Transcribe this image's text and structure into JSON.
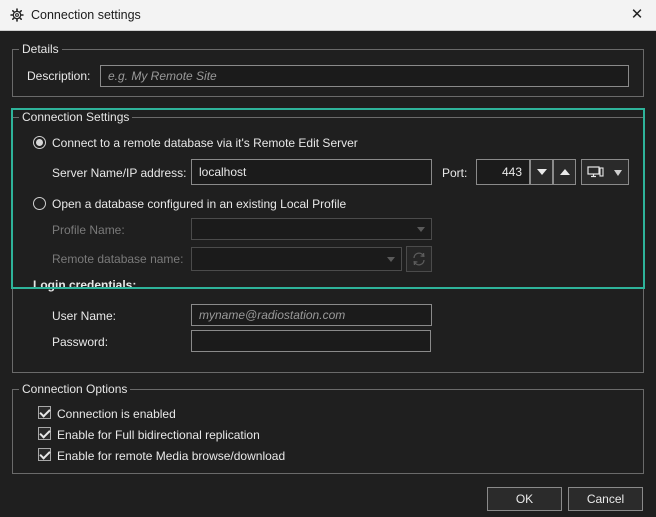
{
  "window": {
    "title": "Connection settings",
    "icon": "gear-icon",
    "close_glyph": "✕"
  },
  "details": {
    "legend": "Details",
    "description_label": "Description:",
    "description_placeholder": "e.g. My Remote Site"
  },
  "connection_settings": {
    "legend": "Connection Settings",
    "option_remote": {
      "label": "Connect to a remote database via it's Remote Edit Server",
      "selected": true
    },
    "server_label": "Server Name/IP address:",
    "server_value": "localhost",
    "port_label": "Port:",
    "port_value": "443",
    "option_local": {
      "label": "Open a database configured in an existing Local Profile",
      "selected": false
    },
    "profile_label": "Profile Name:",
    "remote_db_label": "Remote database name:",
    "login_heading": "Login credentials:",
    "username_label": "User Name:",
    "username_placeholder": "myname@radiostation.com",
    "password_label": "Password:"
  },
  "connection_options": {
    "legend": "Connection Options",
    "items": [
      {
        "label": "Connection is enabled",
        "checked": true
      },
      {
        "label": "Enable for Full bidirectional replication",
        "checked": true
      },
      {
        "label": "Enable for remote Media browse/download",
        "checked": true
      }
    ]
  },
  "buttons": {
    "ok": "OK",
    "cancel": "Cancel"
  },
  "colors": {
    "highlight": "#2eb39a",
    "background": "#1f1f1f"
  }
}
